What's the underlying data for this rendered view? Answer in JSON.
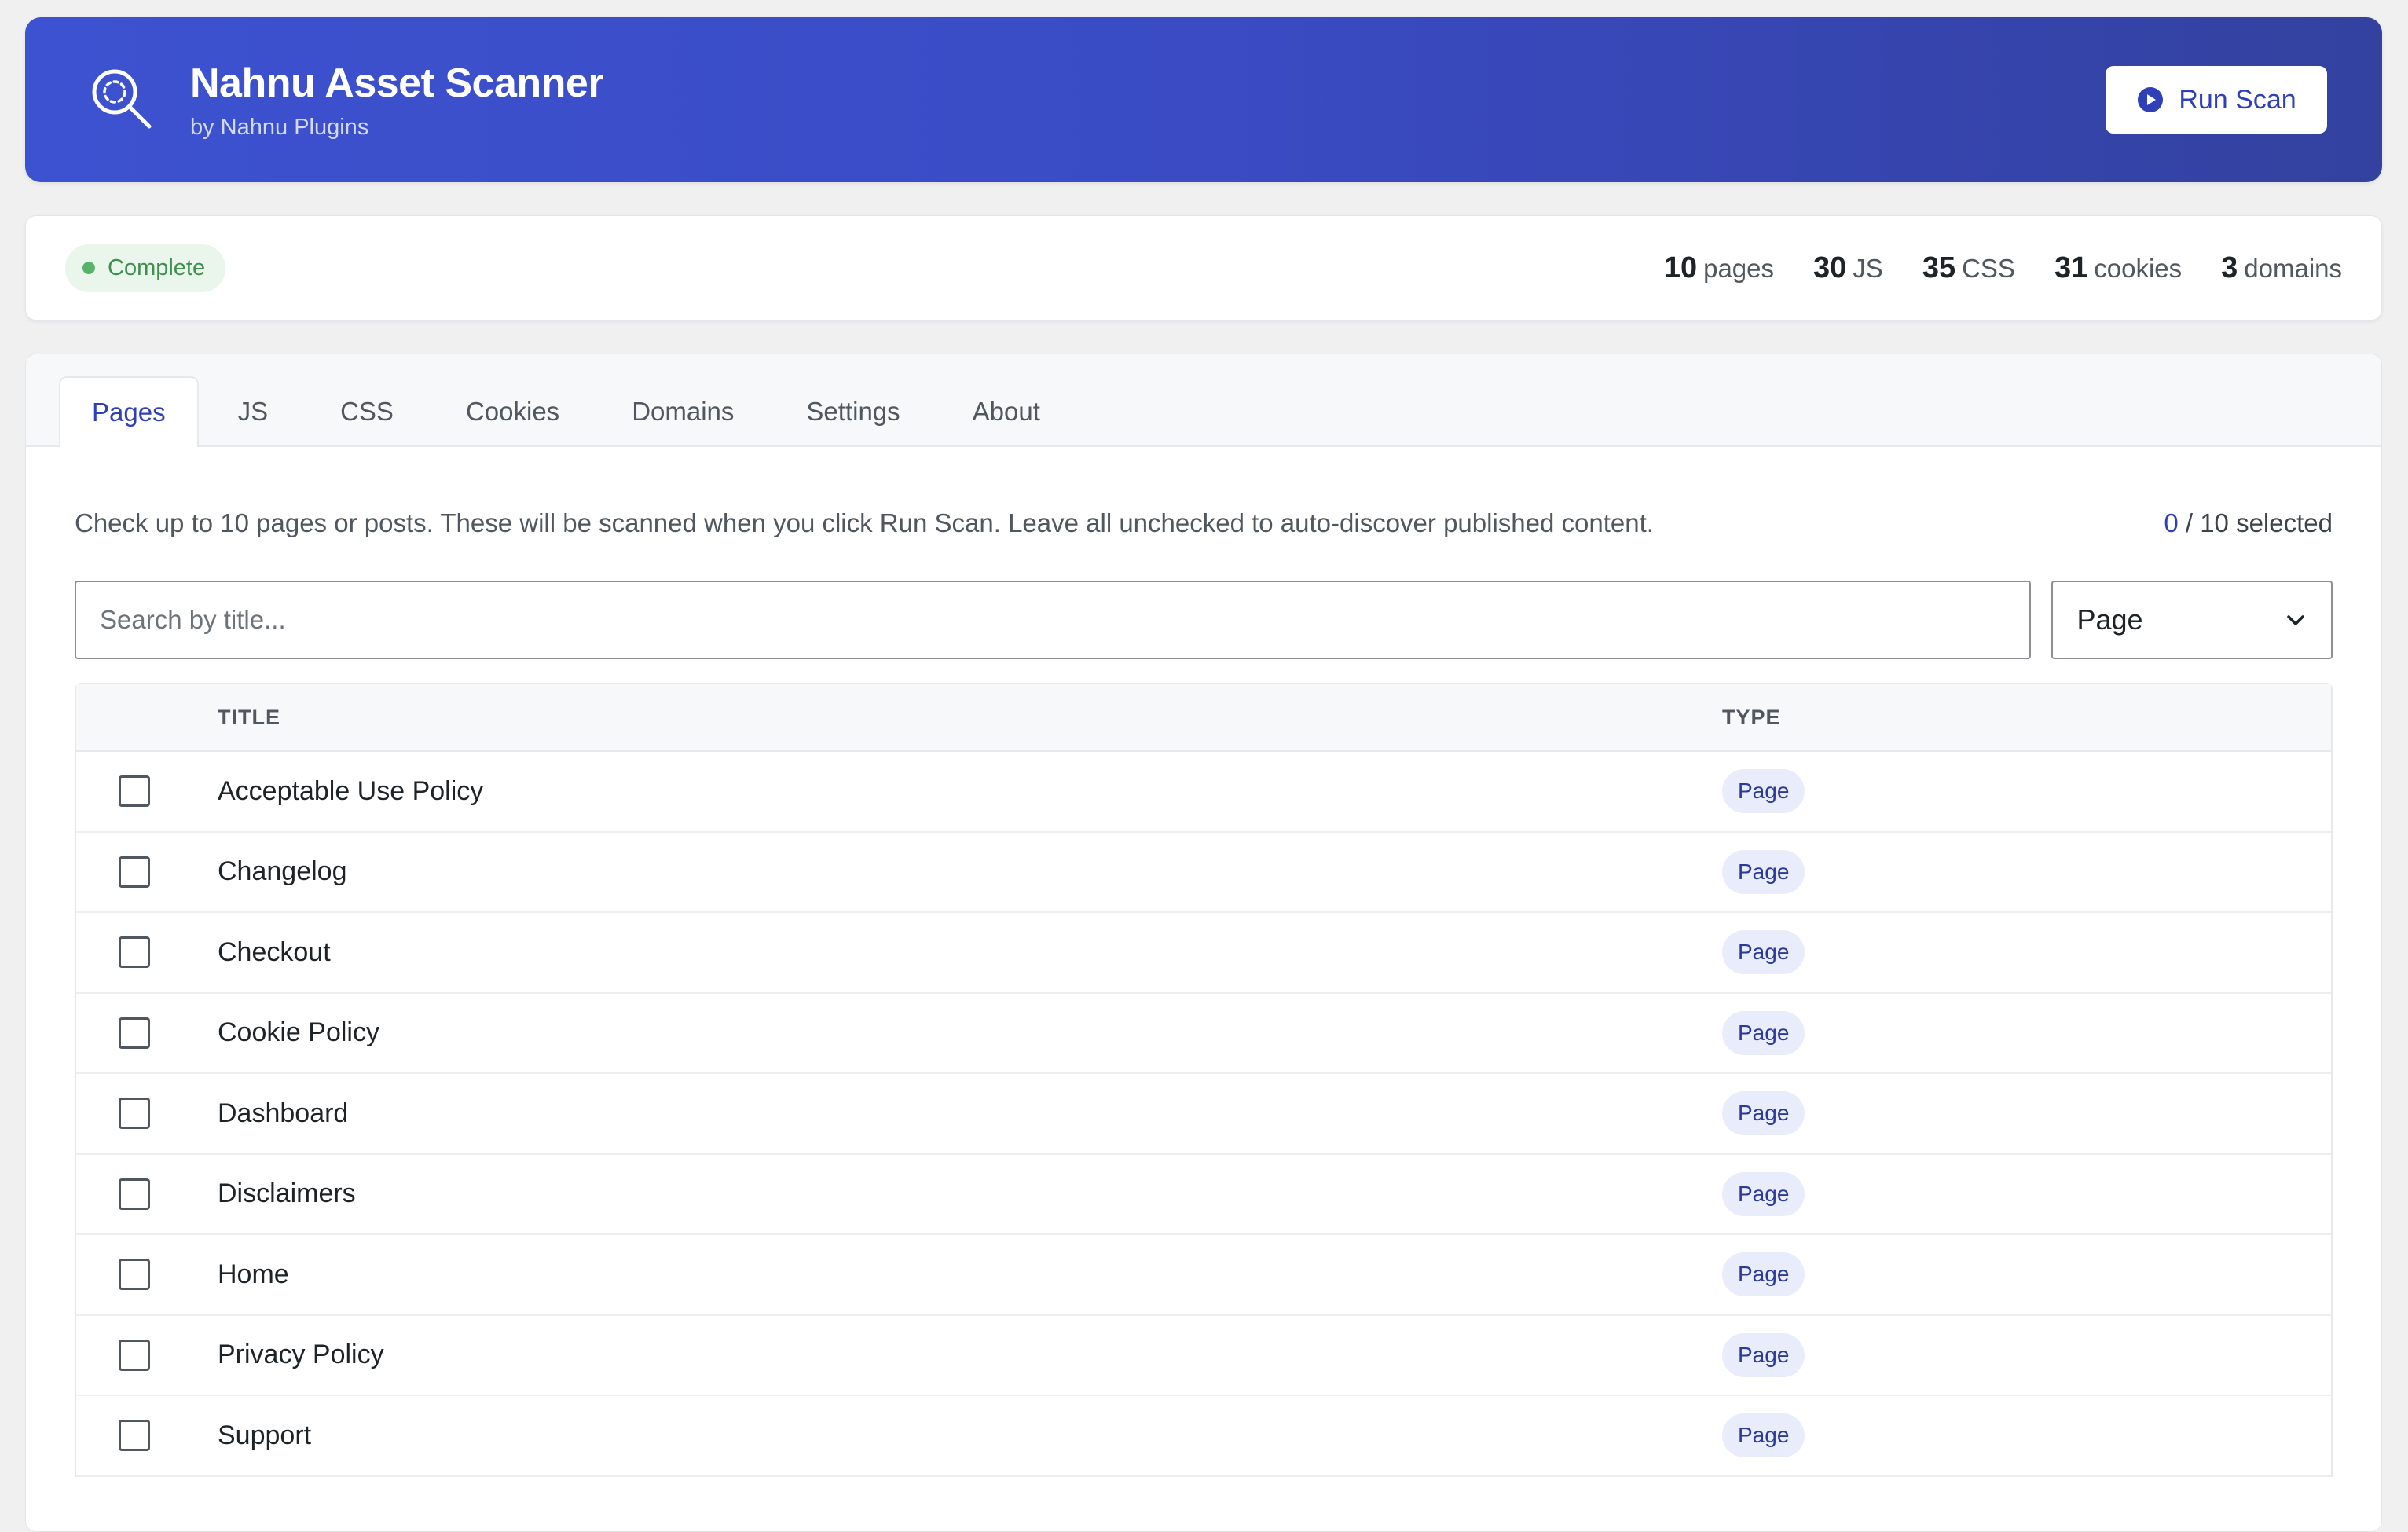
{
  "header": {
    "title": "Nahnu Asset Scanner",
    "subtitle": "by Nahnu Plugins",
    "run_scan_label": "Run Scan",
    "brand_icon": "search-scan-icon",
    "play_icon": "play-circle-icon"
  },
  "status": {
    "badge": "Complete",
    "badge_color": "#57b36a",
    "stats": [
      {
        "value": "10",
        "label": "pages"
      },
      {
        "value": "30",
        "label": "JS"
      },
      {
        "value": "35",
        "label": "CSS"
      },
      {
        "value": "31",
        "label": "cookies"
      },
      {
        "value": "3",
        "label": "domains"
      }
    ]
  },
  "tabs": [
    {
      "label": "Pages",
      "active": true
    },
    {
      "label": "JS"
    },
    {
      "label": "CSS"
    },
    {
      "label": "Cookies"
    },
    {
      "label": "Domains"
    },
    {
      "label": "Settings"
    },
    {
      "label": "About"
    }
  ],
  "pages_tab": {
    "intro": "Check up to 10 pages or posts. These will be scanned when you click Run Scan. Leave all unchecked to auto-discover published content.",
    "selected_count": "0",
    "selected_suffix": " / 10 selected",
    "search_placeholder": "Search by title...",
    "type_filter": "Page",
    "columns": {
      "title": "TITLE",
      "type": "TYPE"
    },
    "rows": [
      {
        "title": "Acceptable Use Policy",
        "type": "Page"
      },
      {
        "title": "Changelog",
        "type": "Page"
      },
      {
        "title": "Checkout",
        "type": "Page"
      },
      {
        "title": "Cookie Policy",
        "type": "Page"
      },
      {
        "title": "Dashboard",
        "type": "Page"
      },
      {
        "title": "Disclaimers",
        "type": "Page"
      },
      {
        "title": "Home",
        "type": "Page"
      },
      {
        "title": "Privacy Policy",
        "type": "Page"
      },
      {
        "title": "Support",
        "type": "Page"
      }
    ]
  },
  "colors": {
    "accent": "#2f3fb7",
    "header_gradient_start": "#3d52d0",
    "header_gradient_end": "#33419f"
  }
}
